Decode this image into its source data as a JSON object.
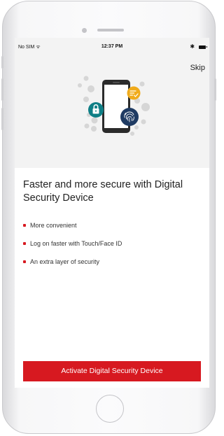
{
  "status_bar": {
    "carrier": "No SIM ᯤ",
    "time": "12:37 PM",
    "bluetooth": "✱"
  },
  "header": {
    "skip_label": "Skip"
  },
  "hero": {
    "icons": [
      "phone-icon",
      "lock-icon",
      "fingerprint-icon",
      "checklist-icon"
    ],
    "colors": {
      "teal": "#0f7f86",
      "navy": "#1f3b63",
      "gold": "#f0ab1c",
      "phone": "#2b2b2b",
      "bubbles": "#d6d6d6"
    }
  },
  "main": {
    "heading": "Faster and more secure with Digital Security Device",
    "bullets": [
      "More convenient",
      "Log on faster with Touch/Face ID",
      "An extra layer of security"
    ],
    "cta_label": "Activate Digital Security Device"
  },
  "theme": {
    "accent": "#d71920",
    "background": "#f3f3f3",
    "card": "#ffffff"
  }
}
